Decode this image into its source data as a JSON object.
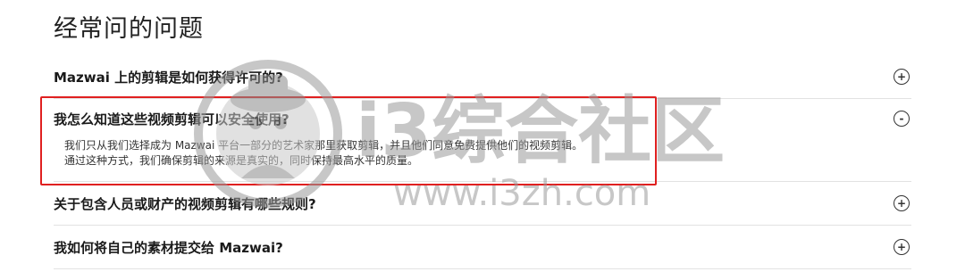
{
  "page": {
    "title": "经常问的问题"
  },
  "faq": [
    {
      "question": "Mazwai 上的剪辑是如何获得许可的?",
      "toggle": "+",
      "open": false
    },
    {
      "question": "我怎么知道这些视频剪辑可以安全使用?",
      "toggle": "-",
      "open": true,
      "answer_line1": "我们只从我们选择成为 Mazwai 平台一部分的艺术家那里获取剪辑，并且他们同意免费提供他们的视频剪辑。",
      "answer_line2": "通过这种方式，我们确保剪辑的来源是真实的，同时保持最高水平的质量。"
    },
    {
      "question": "关于包含人员或财产的视频剪辑有哪些规则?",
      "toggle": "+",
      "open": false
    },
    {
      "question": "我如何将自己的素材提交给 Mazwai?",
      "toggle": "+",
      "open": false
    }
  ],
  "watermark": {
    "text_cn": "i3综合社区",
    "text_url": "www.i3zh.com"
  },
  "colors": {
    "highlight_border": "#e02020",
    "watermark": "#9a9a9a"
  }
}
